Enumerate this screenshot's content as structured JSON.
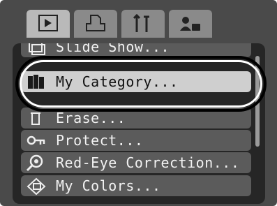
{
  "tabs": [
    {
      "icon": "play-icon",
      "active": true
    },
    {
      "icon": "print-icon",
      "active": false
    },
    {
      "icon": "tools-icon",
      "active": false
    },
    {
      "icon": "my-settings-icon",
      "active": false
    }
  ],
  "menu": {
    "items": [
      {
        "label": "Slide Show...",
        "icon": "slideshow-icon",
        "selected": false
      },
      {
        "label": "My Category...",
        "icon": "category-icon",
        "selected": true
      },
      {
        "label": "Erase...",
        "icon": "trash-icon",
        "selected": false
      },
      {
        "label": "Protect...",
        "icon": "key-icon",
        "selected": false
      },
      {
        "label": "Red-Eye Correction...",
        "icon": "red-eye-icon",
        "selected": false
      },
      {
        "label": "My Colors...",
        "icon": "my-colors-icon",
        "selected": false
      }
    ]
  },
  "colors": {
    "background": "#4a4a4a",
    "menu_bg": "#262626",
    "row": "#5b5b5b",
    "row_selected": "#cfcfcf"
  }
}
